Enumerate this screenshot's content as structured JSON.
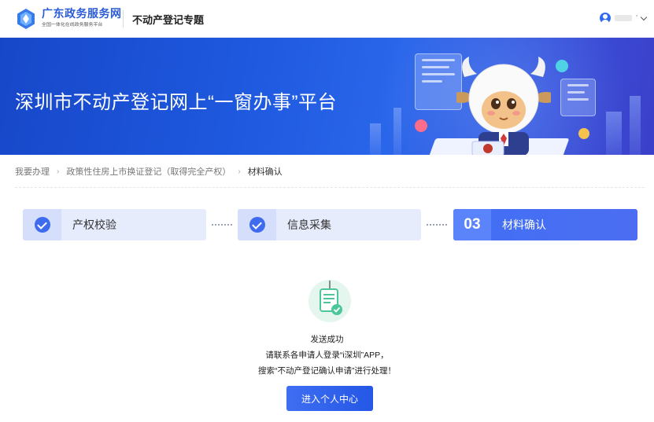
{
  "header": {
    "brand_main": "广东政务服务网",
    "brand_sub": "全国一体化在线政务服务平台",
    "topic_title": "不动产登记专题",
    "user_name": "' "
  },
  "banner": {
    "title": "深圳市不动产登记网上“一窗办事”平台"
  },
  "breadcrumb": {
    "items": [
      "我要办理",
      "政策性住房上市换证登记（取得完全产权）",
      "材料确认"
    ]
  },
  "steps": [
    {
      "label": "产权校验",
      "status": "done"
    },
    {
      "label": "信息采集",
      "status": "done"
    },
    {
      "number": "03",
      "label": "材料确认",
      "status": "active"
    }
  ],
  "result": {
    "title": "发送成功",
    "line1": "请联系各申请人登录“i深圳”APP，",
    "line2": "搜索“不动产登记确认申请”进行处理！",
    "button_label": "进入个人中心"
  },
  "colors": {
    "accent": "#3f6bef",
    "banner": "#1f5ae0",
    "success": "#4cc69a"
  }
}
